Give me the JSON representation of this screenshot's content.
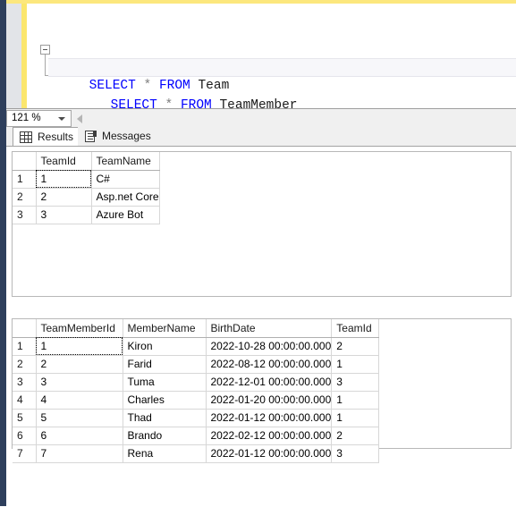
{
  "editor": {
    "lines": [
      {
        "keyword1": "SELECT",
        "star": "*",
        "keyword2": "FROM",
        "table": "Team"
      },
      {
        "keyword1": "SELECT",
        "star": "*",
        "keyword2": "FROM",
        "table": "TeamMember"
      }
    ]
  },
  "toolbar": {
    "zoom_value": "121 %"
  },
  "tabs": [
    {
      "label": "Results",
      "icon": "grid-icon",
      "active": true
    },
    {
      "label": "Messages",
      "icon": "document-icon",
      "active": false
    }
  ],
  "grids": [
    {
      "name": "team-results",
      "columns": [
        "",
        "TeamId",
        "TeamName"
      ],
      "rows": [
        {
          "num": "1",
          "cells": [
            "1",
            "C#"
          ]
        },
        {
          "num": "2",
          "cells": [
            "2",
            "Asp.net Core"
          ]
        },
        {
          "num": "3",
          "cells": [
            "3",
            "Azure Bot"
          ]
        }
      ]
    },
    {
      "name": "teammember-results",
      "columns": [
        "",
        "TeamMemberId",
        "MemberName",
        "BirthDate",
        "TeamId"
      ],
      "rows": [
        {
          "num": "1",
          "cells": [
            "1",
            "Kiron",
            "2022-10-28 00:00:00.000",
            "2"
          ]
        },
        {
          "num": "2",
          "cells": [
            "2",
            "Farid",
            "2022-08-12 00:00:00.000",
            "1"
          ]
        },
        {
          "num": "3",
          "cells": [
            "3",
            "Tuma",
            "2022-12-01 00:00:00.000",
            "3"
          ]
        },
        {
          "num": "4",
          "cells": [
            "4",
            "Charles",
            "2022-01-20 00:00:00.000",
            "1"
          ]
        },
        {
          "num": "5",
          "cells": [
            "5",
            "Thad",
            "2022-01-12 00:00:00.000",
            "1"
          ]
        },
        {
          "num": "6",
          "cells": [
            "6",
            "Brando",
            "2022-02-12 00:00:00.000",
            "2"
          ]
        },
        {
          "num": "7",
          "cells": [
            "7",
            "Rena",
            "2022-01-12 00:00:00.000",
            "3"
          ]
        }
      ]
    }
  ],
  "colors": {
    "keyword": "#0000ff",
    "operator": "#808080",
    "change_bar": "#fbe66d",
    "dock_strip": "#2e3f5c",
    "selection": "#e4eaf0"
  }
}
